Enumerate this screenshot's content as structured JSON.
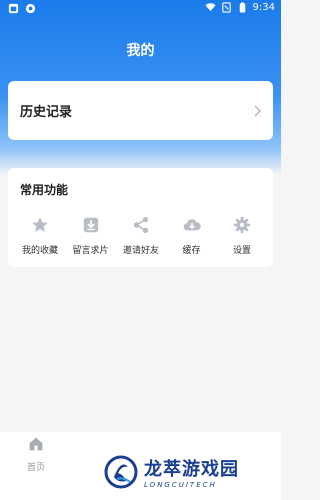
{
  "status_bar": {
    "time": "9:34"
  },
  "header": {
    "title": "我的"
  },
  "history": {
    "label": "历史记录"
  },
  "functions": {
    "title": "常用功能",
    "items": [
      {
        "label": "我的收藏",
        "icon": "star-icon"
      },
      {
        "label": "留言求片",
        "icon": "download-box-icon"
      },
      {
        "label": "邀请好友",
        "icon": "share-icon"
      },
      {
        "label": "缓存",
        "icon": "cloud-download-icon"
      },
      {
        "label": "设置",
        "icon": "gear-icon"
      }
    ]
  },
  "tabbar": {
    "home_label": "首页"
  },
  "watermark": {
    "brand_cn": "龙萃游戏园",
    "brand_en": "LONGCUITECH"
  },
  "colors": {
    "accent": "#1a7bea",
    "icon_gray": "#b9bdc6"
  }
}
